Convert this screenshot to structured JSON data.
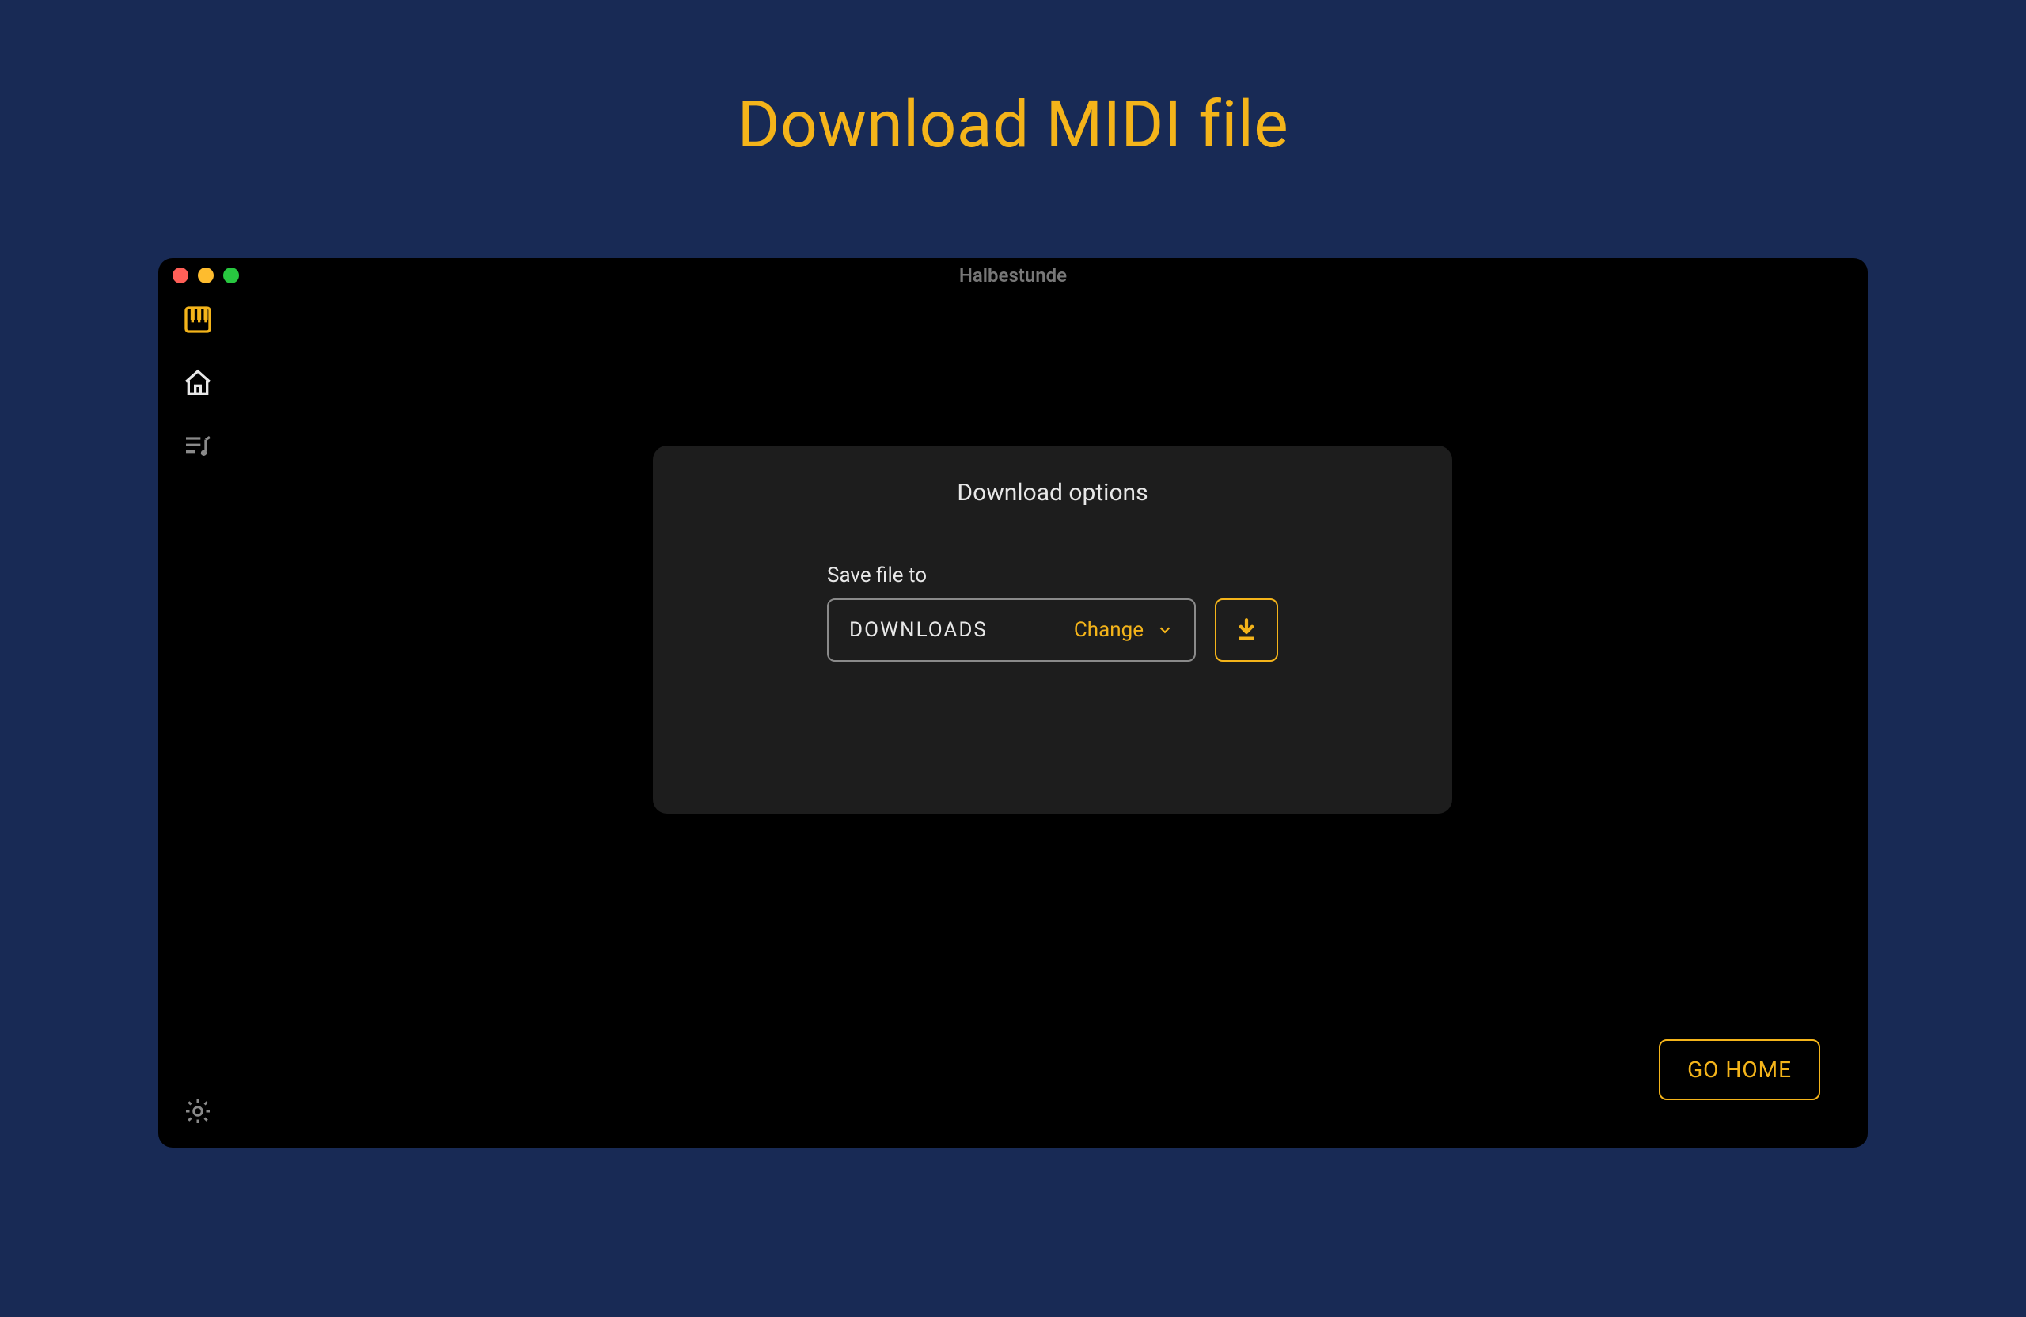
{
  "page": {
    "title": "Download MIDI file"
  },
  "window": {
    "title": "Halbestunde"
  },
  "dialog": {
    "heading": "Download options",
    "field_label": "Save file to",
    "destination": "DOWNLOADS",
    "change_label": "Change"
  },
  "buttons": {
    "go_home": "GO HOME"
  },
  "colors": {
    "accent": "#f4b41a",
    "bg": "#182a55"
  }
}
